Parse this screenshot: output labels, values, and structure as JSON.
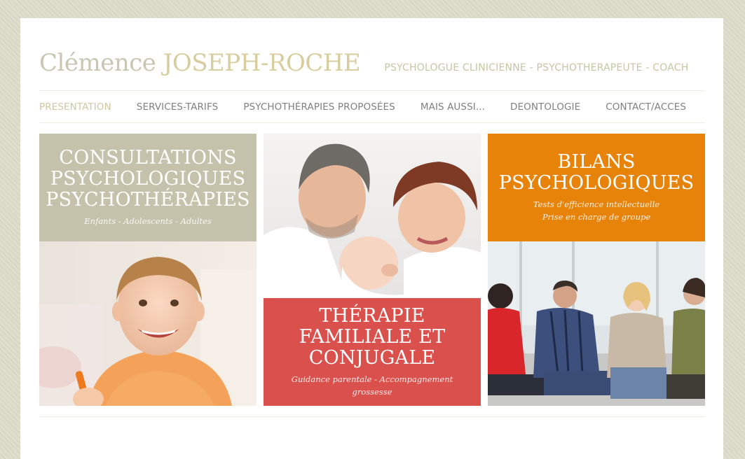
{
  "header": {
    "name_first": "Clémence",
    "name_last": "JOSEPH-ROCHE",
    "tagline": "PSYCHOLOGUE CLINICIENNE - PSYCHOTHERAPEUTE - COACH"
  },
  "nav": {
    "items": [
      {
        "label": "PRESENTATION",
        "active": true
      },
      {
        "label": "SERVICES-TARIFS",
        "active": false
      },
      {
        "label": "PSYCHOTHÉRAPIES PROPOSÉES",
        "active": false
      },
      {
        "label": "MAIS AUSSI...",
        "active": false
      },
      {
        "label": "DEONTOLOGIE",
        "active": false
      },
      {
        "label": "CONTACT/ACCES",
        "active": false
      }
    ]
  },
  "tiles": {
    "consultations": {
      "title": "CONSULTATIONS\nPSYCHOLOGIQUES\nPSYCHOTHÉRAPIES",
      "subtitle": "Enfants - Adolescents - Adultes",
      "color": "#c4c2aa"
    },
    "therapie": {
      "title": "THÉRAPIE\nFAMILIALE ET\nCONJUGALE",
      "subtitle": "Guidance parentale - Accompagnement\ngrossesse",
      "color": "#d9504c"
    },
    "bilans": {
      "title": "BILANS\nPSYCHOLOGIQUES",
      "subtitle": "Tests d'efficience intellectuelle\nPrise en charge de groupe",
      "color": "#e8830a"
    }
  },
  "colors": {
    "background": "#d9d8c6",
    "accent_logo": "#d8cd9e",
    "nav_active": "#d0c7a0",
    "nav_text": "#808080"
  }
}
